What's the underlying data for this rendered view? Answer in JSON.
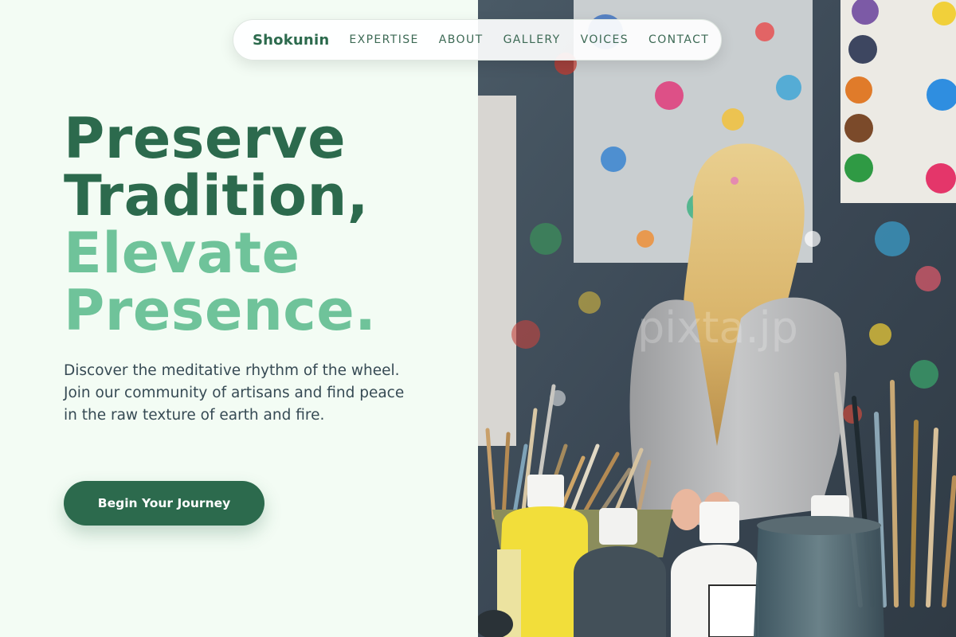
{
  "nav": {
    "brand": "Shokunin",
    "links": [
      "EXPERTISE",
      "ABOUT",
      "GALLERY",
      "VOICES",
      "CONTACT"
    ]
  },
  "hero": {
    "headline": {
      "line1": "Preserve",
      "line2": "Tradition,",
      "line3": "Elevate",
      "line4": "Presence."
    },
    "description": "Discover the meditative rhythm of the wheel. Join our community of artisans and find peace in the raw texture of earth and fire.",
    "cta_label": "Begin Your Journey",
    "image_watermark": "pixta.jp"
  },
  "colors": {
    "background": "#f3fcf4",
    "primary": "#2c6a4d",
    "accent": "#6fc39a",
    "body_text": "#364a54"
  },
  "image": {
    "semantic": "hero-photo-child-painting-studio"
  }
}
